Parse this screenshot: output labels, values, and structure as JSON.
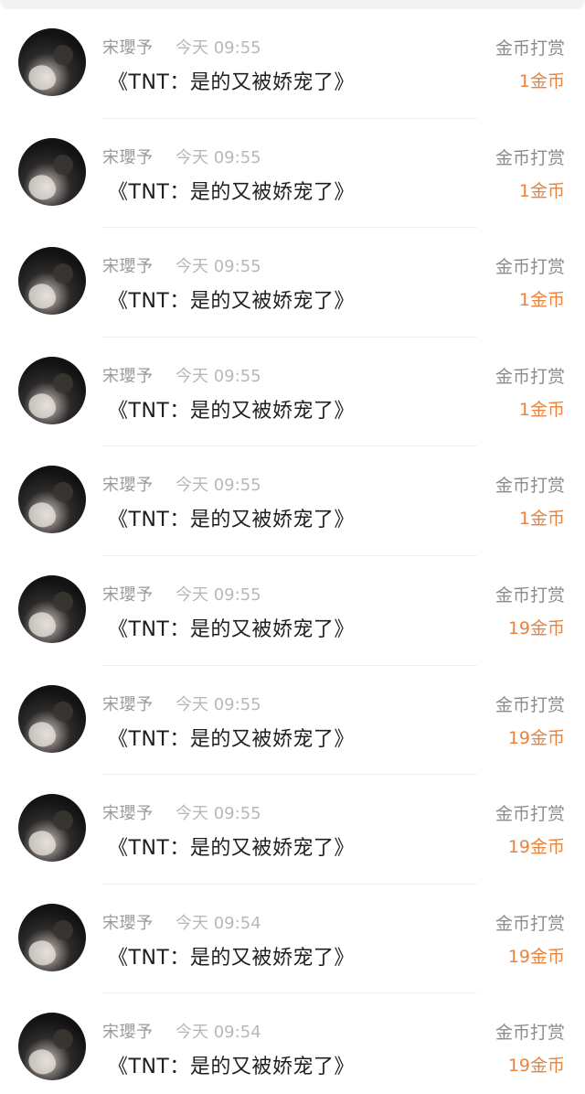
{
  "records": [
    {
      "user": "宋瓔予",
      "time": "今天 09:55",
      "book": "《TNT：是的又被娇宠了》",
      "type": "金币打赏",
      "amount": "1金币"
    },
    {
      "user": "宋瓔予",
      "time": "今天 09:55",
      "book": "《TNT：是的又被娇宠了》",
      "type": "金币打赏",
      "amount": "1金币"
    },
    {
      "user": "宋瓔予",
      "time": "今天 09:55",
      "book": "《TNT：是的又被娇宠了》",
      "type": "金币打赏",
      "amount": "1金币"
    },
    {
      "user": "宋瓔予",
      "time": "今天 09:55",
      "book": "《TNT：是的又被娇宠了》",
      "type": "金币打赏",
      "amount": "1金币"
    },
    {
      "user": "宋瓔予",
      "time": "今天 09:55",
      "book": "《TNT：是的又被娇宠了》",
      "type": "金币打赏",
      "amount": "1金币"
    },
    {
      "user": "宋瓔予",
      "time": "今天 09:55",
      "book": "《TNT：是的又被娇宠了》",
      "type": "金币打赏",
      "amount": "19金币"
    },
    {
      "user": "宋瓔予",
      "time": "今天 09:55",
      "book": "《TNT：是的又被娇宠了》",
      "type": "金币打赏",
      "amount": "19金币"
    },
    {
      "user": "宋瓔予",
      "time": "今天 09:55",
      "book": "《TNT：是的又被娇宠了》",
      "type": "金币打赏",
      "amount": "19金币"
    },
    {
      "user": "宋瓔予",
      "time": "今天 09:54",
      "book": "《TNT：是的又被娇宠了》",
      "type": "金币打赏",
      "amount": "19金币"
    },
    {
      "user": "宋瓔予",
      "time": "今天 09:54",
      "book": "《TNT：是的又被娇宠了》",
      "type": "金币打赏",
      "amount": "19金币"
    }
  ],
  "colors": {
    "amount": "#e8843d",
    "name": "#9a9a9a",
    "time": "#b8b8b8",
    "title": "#1f1f1f",
    "type": "#8c8c8c"
  }
}
